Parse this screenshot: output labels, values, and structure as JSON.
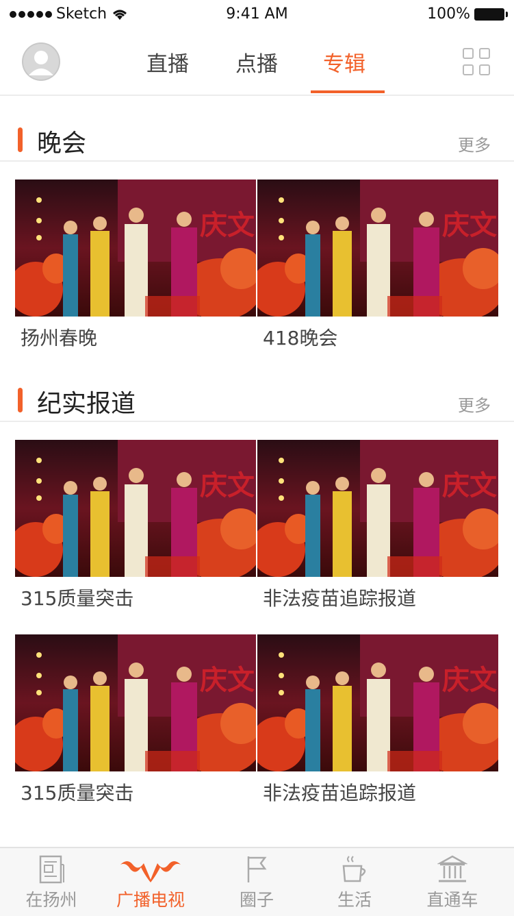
{
  "status_bar": {
    "carrier": "Sketch",
    "time": "9:41 AM",
    "battery": "100%"
  },
  "nav": {
    "tabs": [
      {
        "label": "直播"
      },
      {
        "label": "点播"
      },
      {
        "label": "专辑",
        "active": true
      }
    ]
  },
  "sections": [
    {
      "title": "晚会",
      "more": "更多",
      "items": [
        {
          "label": "扬州春晚"
        },
        {
          "label": "418晚会"
        }
      ]
    },
    {
      "title": "纪实报道",
      "more": "更多",
      "items": [
        {
          "label": "315质量突击"
        },
        {
          "label": "非法疫苗追踪报道"
        },
        {
          "label": "315质量突击"
        },
        {
          "label": "非法疫苗追踪报道"
        }
      ]
    }
  ],
  "tab_bar": {
    "items": [
      {
        "label": "在扬州",
        "icon": "newspaper-icon"
      },
      {
        "label": "广播电视",
        "icon": "broadcast-logo-icon",
        "active": true
      },
      {
        "label": "圈子",
        "icon": "flag-icon"
      },
      {
        "label": "生活",
        "icon": "coffee-cup-icon"
      },
      {
        "label": "直通车",
        "icon": "government-building-icon"
      }
    ]
  },
  "colors": {
    "accent": "#f2612a",
    "divider": "#ececec"
  }
}
